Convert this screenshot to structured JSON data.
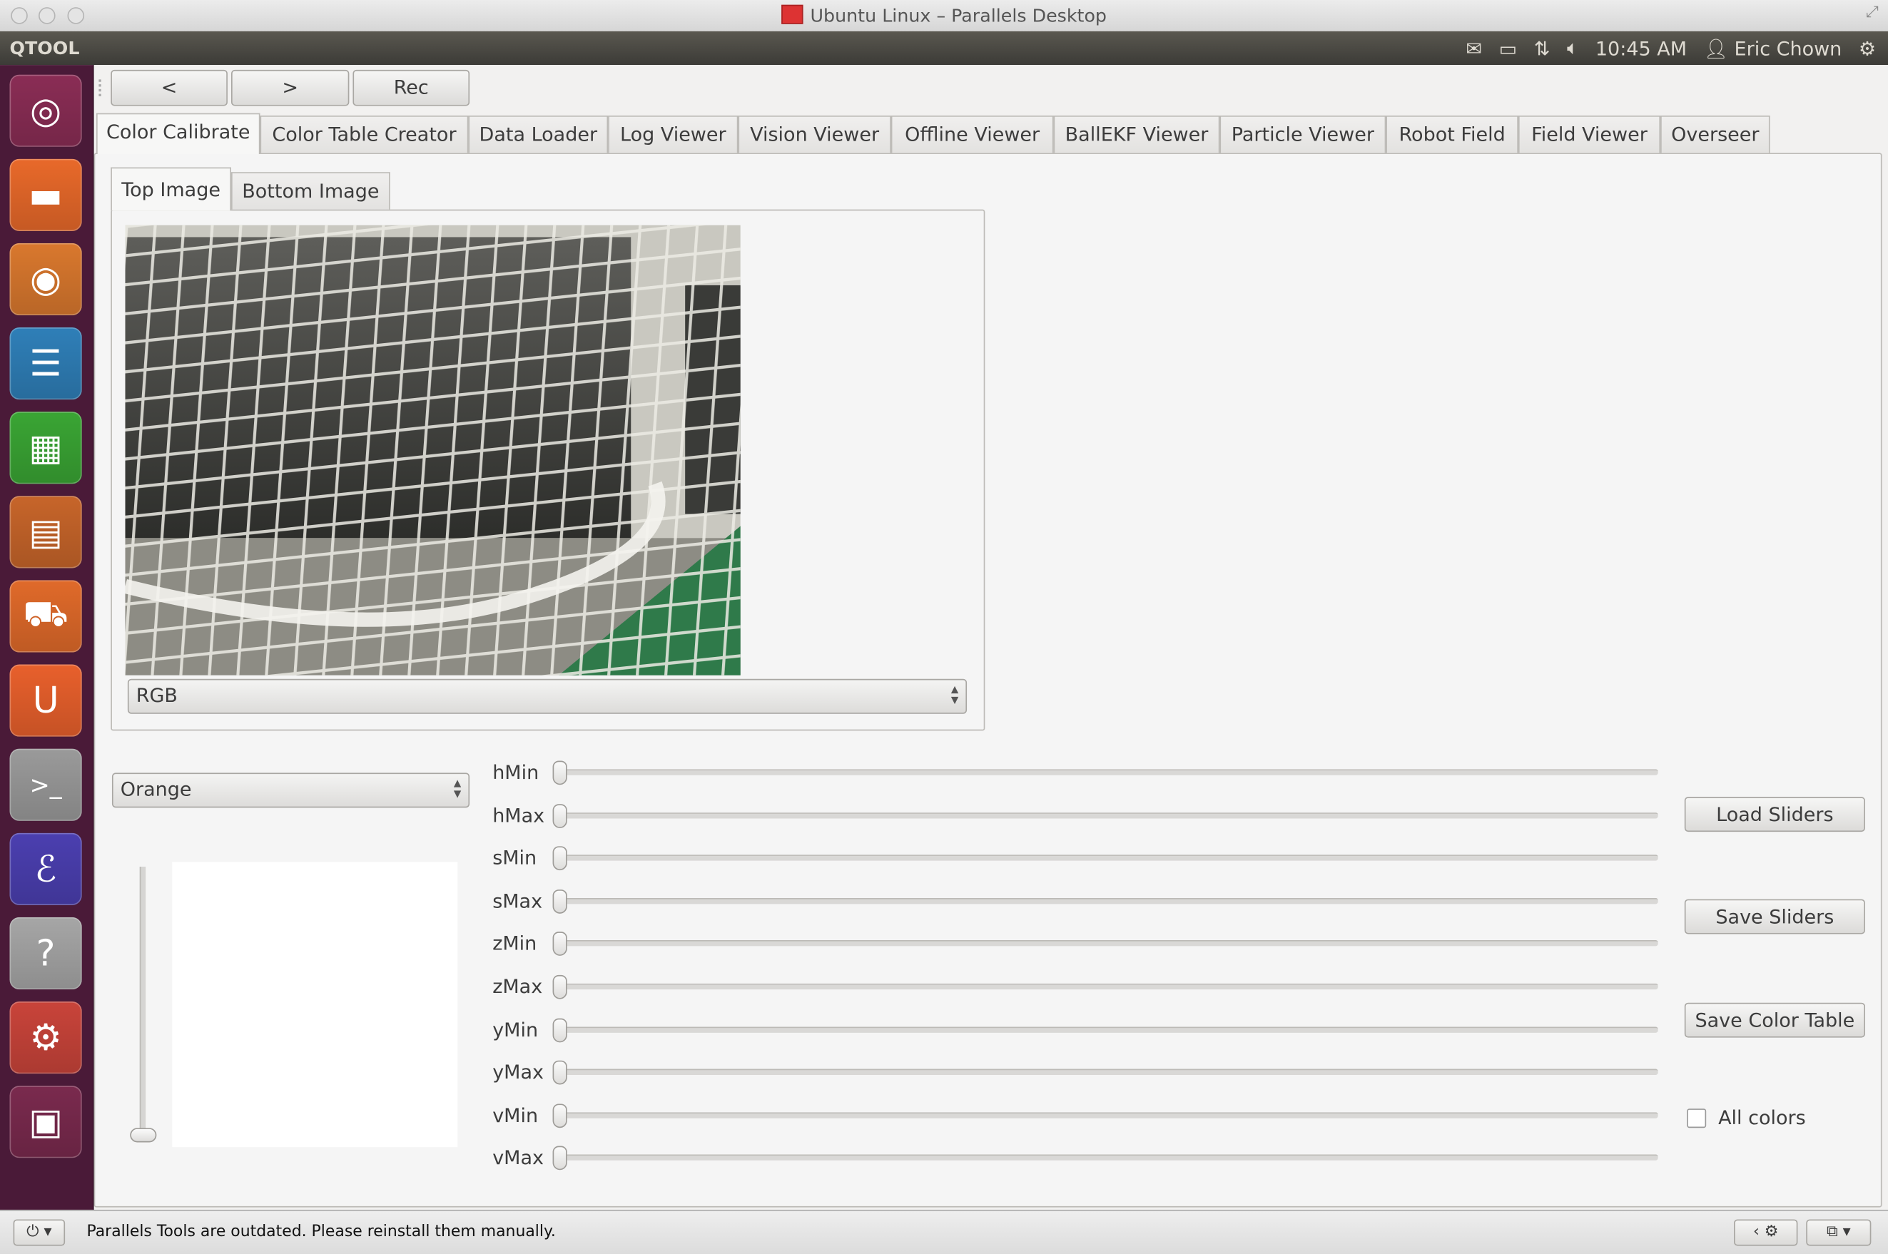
{
  "mac_window": {
    "title": "Ubuntu Linux – Parallels Desktop"
  },
  "top_panel": {
    "app_name": "QTOOL",
    "time": "10:45 AM",
    "user": "Eric Chown",
    "icons": [
      "mail-icon",
      "battery-icon",
      "network-icon",
      "volume-icon",
      "user-icon",
      "power-gear-icon"
    ]
  },
  "launcher": {
    "items": [
      {
        "name": "dash-home",
        "color": "#8a2d55",
        "glyph": "◎"
      },
      {
        "name": "files",
        "color": "#e8692a",
        "glyph": "▬"
      },
      {
        "name": "firefox",
        "color": "#d9782e",
        "glyph": "◉"
      },
      {
        "name": "libreoffice-writer",
        "color": "#2f7fb8",
        "glyph": "☰"
      },
      {
        "name": "libreoffice-calc",
        "color": "#3aa534",
        "glyph": "▦"
      },
      {
        "name": "libreoffice-impress",
        "color": "#c7652a",
        "glyph": "▤"
      },
      {
        "name": "software-center",
        "color": "#e06a2a",
        "glyph": "⛟"
      },
      {
        "name": "ubuntu-one",
        "color": "#e8602c",
        "glyph": "U"
      },
      {
        "name": "terminal",
        "color": "#9a9a9a",
        "glyph": ">_"
      },
      {
        "name": "emacs",
        "color": "#4b3fb0",
        "glyph": "ℰ"
      },
      {
        "name": "help",
        "color": "#a6a6a6",
        "glyph": "?"
      },
      {
        "name": "system-settings",
        "color": "#c9443a",
        "glyph": "⚙"
      },
      {
        "name": "workspace-switcher",
        "color": "#7a2a4e",
        "glyph": "▣"
      }
    ]
  },
  "toolbar": {
    "prev_label": "<",
    "next_label": ">",
    "rec_label": "Rec"
  },
  "tabs": [
    "Color Calibrate",
    "Color Table Creator",
    "Data Loader",
    "Log Viewer",
    "Vision Viewer",
    "Offline Viewer",
    "BallEKF Viewer",
    "Particle Viewer",
    "Robot Field",
    "Field Viewer",
    "Overseer"
  ],
  "selected_tab": "Color Calibrate",
  "sub_tabs": [
    "Top Image",
    "Bottom Image"
  ],
  "selected_sub_tab": "Top Image",
  "image_mode_select": {
    "value": "RGB"
  },
  "color_select": {
    "value": "Orange"
  },
  "vertical_slider": {
    "value_fraction": 0
  },
  "sliders": [
    {
      "label": "hMin",
      "value_fraction": 0
    },
    {
      "label": "hMax",
      "value_fraction": 0
    },
    {
      "label": "sMin",
      "value_fraction": 0
    },
    {
      "label": "sMax",
      "value_fraction": 0
    },
    {
      "label": "zMin",
      "value_fraction": 0
    },
    {
      "label": "zMax",
      "value_fraction": 0
    },
    {
      "label": "yMin",
      "value_fraction": 0
    },
    {
      "label": "yMax",
      "value_fraction": 0
    },
    {
      "label": "vMin",
      "value_fraction": 0
    },
    {
      "label": "vMax",
      "value_fraction": 0
    }
  ],
  "buttons": {
    "load_sliders": "Load Sliders",
    "save_sliders": "Save Sliders",
    "save_color_table": "Save Color Table"
  },
  "all_colors": {
    "label": "All colors",
    "checked": false
  },
  "status_bar": {
    "message": "Parallels Tools are outdated. Please reinstall them manually."
  },
  "colors": {
    "launcher_bg": "#4a1a38",
    "panel_bg": "#3c3b37",
    "window_bg": "#f2f1f0"
  }
}
